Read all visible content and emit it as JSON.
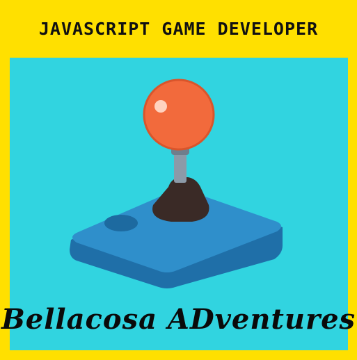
{
  "header": {
    "title": "JAVASCRIPT GAME DEVELOPER"
  },
  "brand": {
    "name": "Bellacosa ADventures"
  },
  "colors": {
    "frame": "#FFE000",
    "background": "#31D4E0",
    "base_top": "#2F8FCB",
    "base_side": "#1F6FA8",
    "ball": "#F26A3C",
    "stick": "#8C9AA8",
    "boot": "#3A2A26",
    "text": "#0a0a0a"
  },
  "icon": "joystick-icon"
}
